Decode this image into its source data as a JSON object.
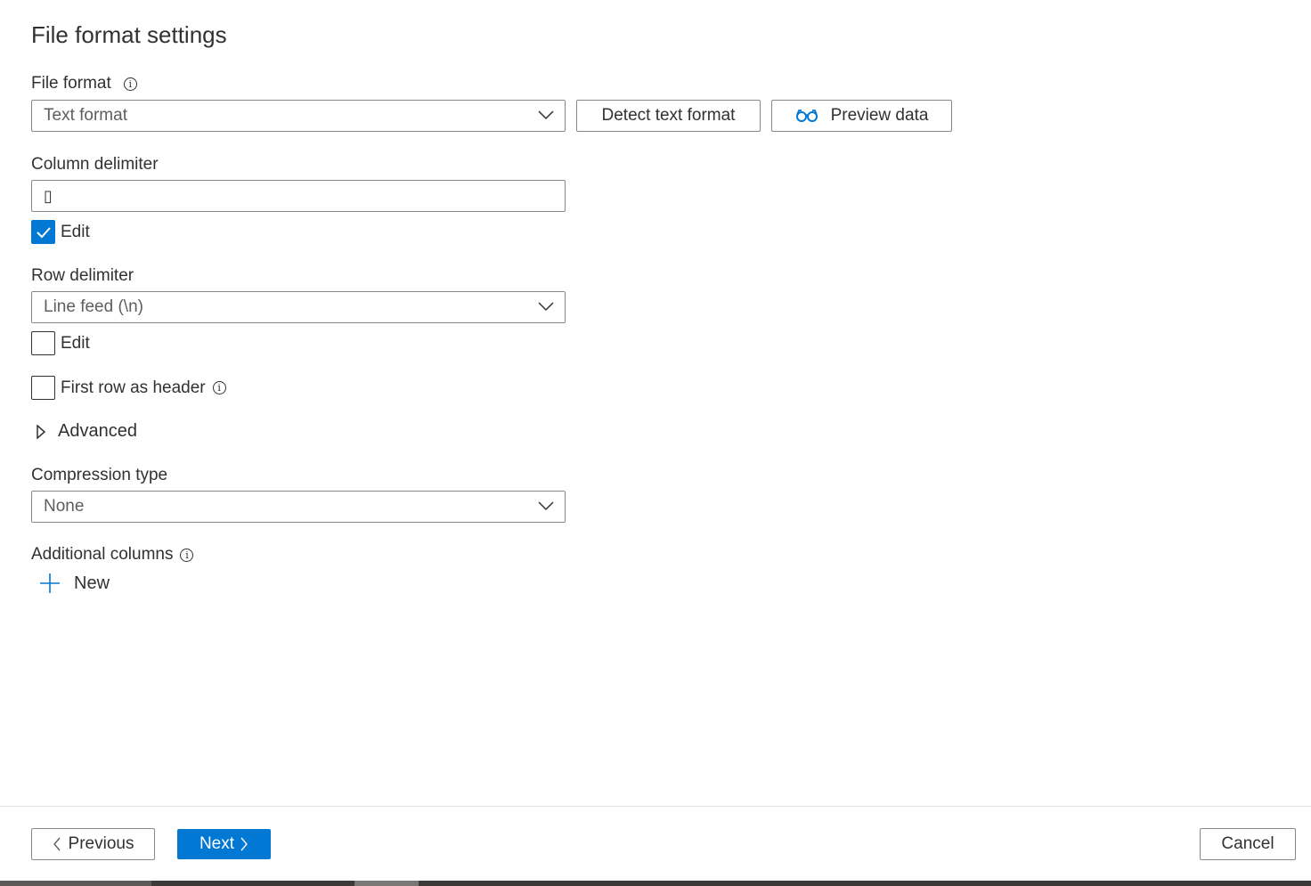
{
  "page": {
    "title": "File format settings"
  },
  "file_format": {
    "label": "File format",
    "value": "Text format",
    "detect_button": "Detect text format",
    "preview_button": "Preview data"
  },
  "column_delimiter": {
    "label": "Column delimiter",
    "value": "▯",
    "edit_label": "Edit",
    "edit_checked": true
  },
  "row_delimiter": {
    "label": "Row delimiter",
    "value": "Line feed (\\n)",
    "edit_label": "Edit",
    "edit_checked": false
  },
  "first_row_header": {
    "label": "First row as header",
    "checked": false
  },
  "advanced": {
    "label": "Advanced"
  },
  "compression": {
    "label": "Compression type",
    "value": "None"
  },
  "additional_columns": {
    "label": "Additional columns",
    "new_label": "New"
  },
  "footer": {
    "previous": "Previous",
    "next": "Next",
    "cancel": "Cancel"
  },
  "colors": {
    "accent": "#0078d4",
    "text": "#323130",
    "border": "#8a8886"
  }
}
